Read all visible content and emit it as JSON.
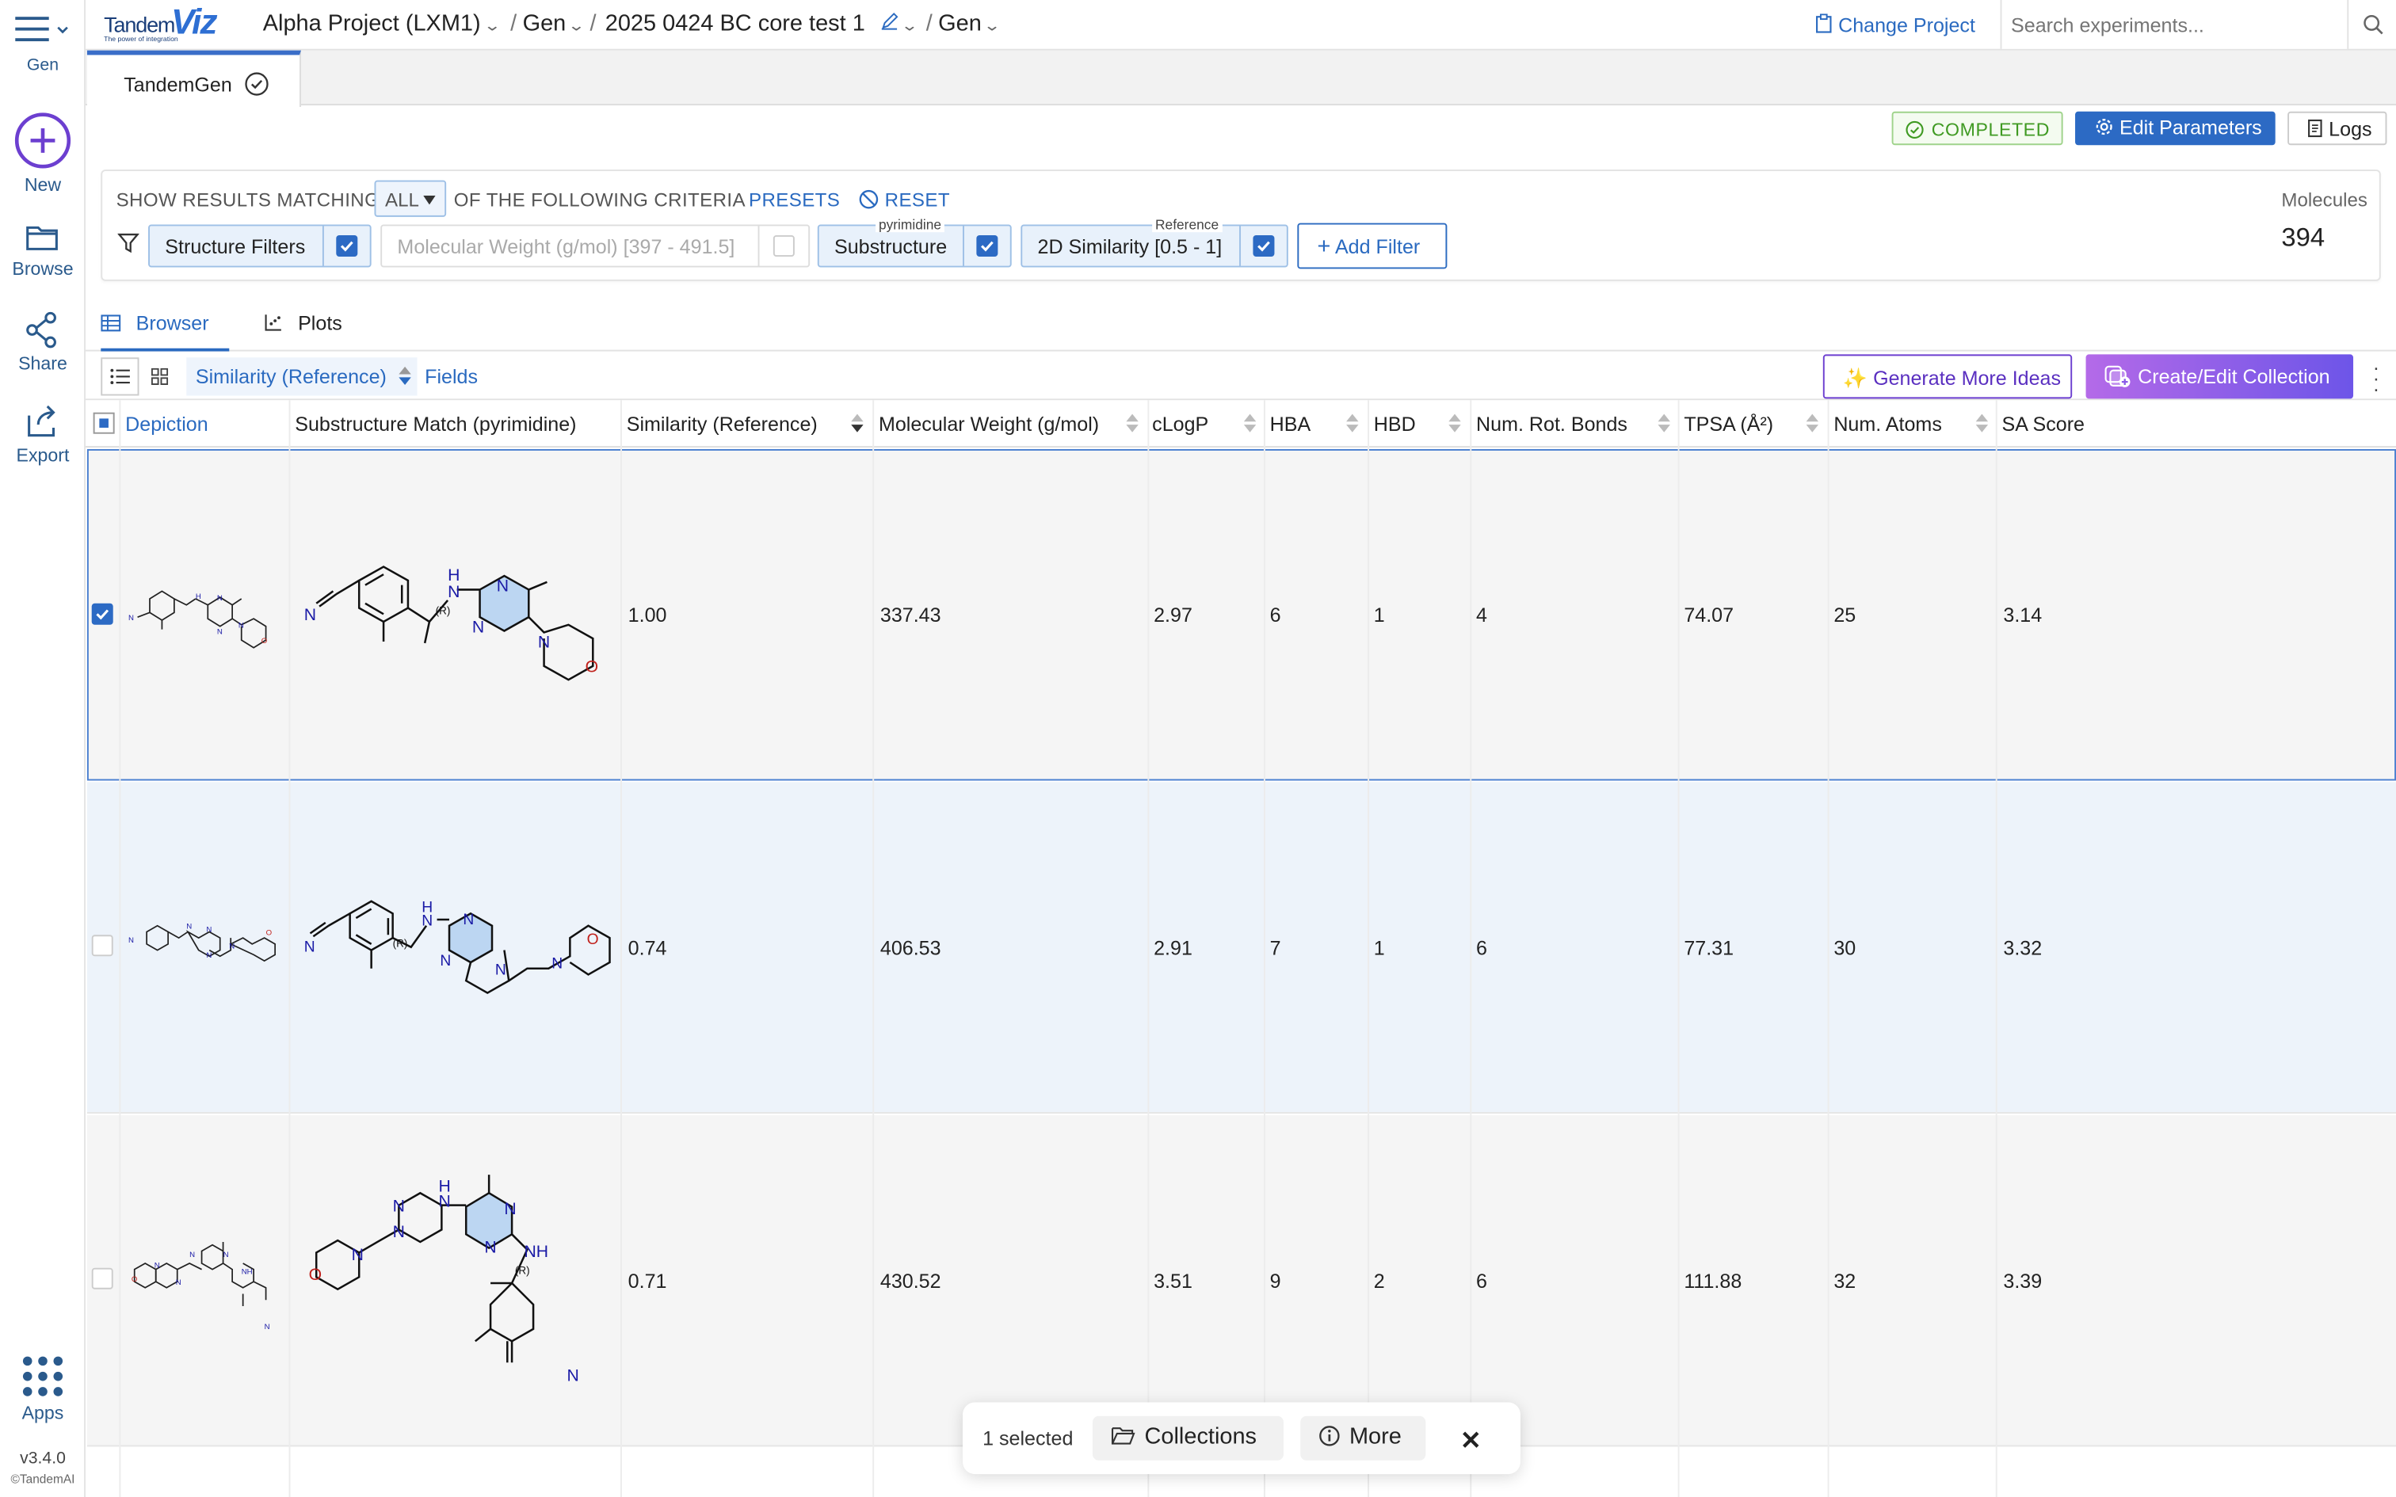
{
  "rail": {
    "menu_label": "Gen",
    "items": [
      {
        "label": "New",
        "icon": "plus-circle-icon"
      },
      {
        "label": "Browse",
        "icon": "folder-icon"
      },
      {
        "label": "Share",
        "icon": "share-icon"
      },
      {
        "label": "Export",
        "icon": "export-icon"
      }
    ],
    "apps_label": "Apps",
    "version": "v3.4.0",
    "copyright": "©TandemAI"
  },
  "header": {
    "logo_main": "Tandem",
    "logo_accent": "Viz",
    "logo_tagline": "The power of integration",
    "breadcrumb": [
      "Alpha Project (LXM1)",
      "Gen",
      "2025 0424 BC core test 1",
      "Gen"
    ],
    "change_project": "Change Project",
    "search_placeholder": "Search experiments..."
  },
  "tabs": [
    {
      "label": "TandemGen",
      "status_icon": "check-circle-icon"
    }
  ],
  "actions": {
    "status": "COMPLETED",
    "edit_parameters": "Edit Parameters",
    "logs": "Logs"
  },
  "filters": {
    "show_results_prefix": "SHOW RESULTS MATCHING",
    "match_mode": "ALL",
    "show_results_suffix": "OF THE FOLLOWING CRITERIA",
    "presets": "PRESETS",
    "reset": "RESET",
    "chips": [
      {
        "label": "Structure Filters",
        "tag": "",
        "enabled": true
      },
      {
        "label": "Molecular Weight (g/mol) [397 - 491.5]",
        "tag": "",
        "enabled": false
      },
      {
        "label": "Substructure",
        "tag": "pyrimidine",
        "enabled": true
      },
      {
        "label": "2D Similarity [0.5 - 1]",
        "tag": "Reference",
        "enabled": true
      }
    ],
    "add_filter": "Add Filter",
    "molecules_label": "Molecules",
    "molecules_count": "394"
  },
  "view_tabs": {
    "browser": "Browser",
    "plots": "Plots"
  },
  "toolbar": {
    "sort_field": "Similarity (Reference)",
    "fields": "Fields",
    "generate": "Generate More Ideas",
    "collection": "Create/Edit Collection"
  },
  "columns": [
    "Depiction",
    "Substructure Match (pyrimidine)",
    "Similarity (Reference)",
    "Molecular Weight (g/mol)",
    "cLogP",
    "HBA",
    "HBD",
    "Num. Rot. Bonds",
    "TPSA (Å²)",
    "Num. Atoms",
    "SA Score"
  ],
  "rows": [
    {
      "selected": true,
      "similarity": "1.00",
      "mw": "337.43",
      "clogp": "2.97",
      "hba": "6",
      "hbd": "1",
      "rot": "4",
      "tpsa": "74.07",
      "atoms": "25",
      "sa": "3.14"
    },
    {
      "selected": false,
      "similarity": "0.74",
      "mw": "406.53",
      "clogp": "2.91",
      "hba": "7",
      "hbd": "1",
      "rot": "6",
      "tpsa": "77.31",
      "atoms": "30",
      "sa": "3.32"
    },
    {
      "selected": false,
      "similarity": "0.71",
      "mw": "430.52",
      "clogp": "3.51",
      "hba": "9",
      "hbd": "2",
      "rot": "6",
      "tpsa": "111.88",
      "atoms": "32",
      "sa": "3.39"
    }
  ],
  "atoms": {
    "n": "N",
    "h": "H",
    "o": "O",
    "nh": "NH",
    "r": "(R)"
  },
  "selection_bar": {
    "count": "1 selected",
    "collections": "Collections",
    "more": "More"
  }
}
